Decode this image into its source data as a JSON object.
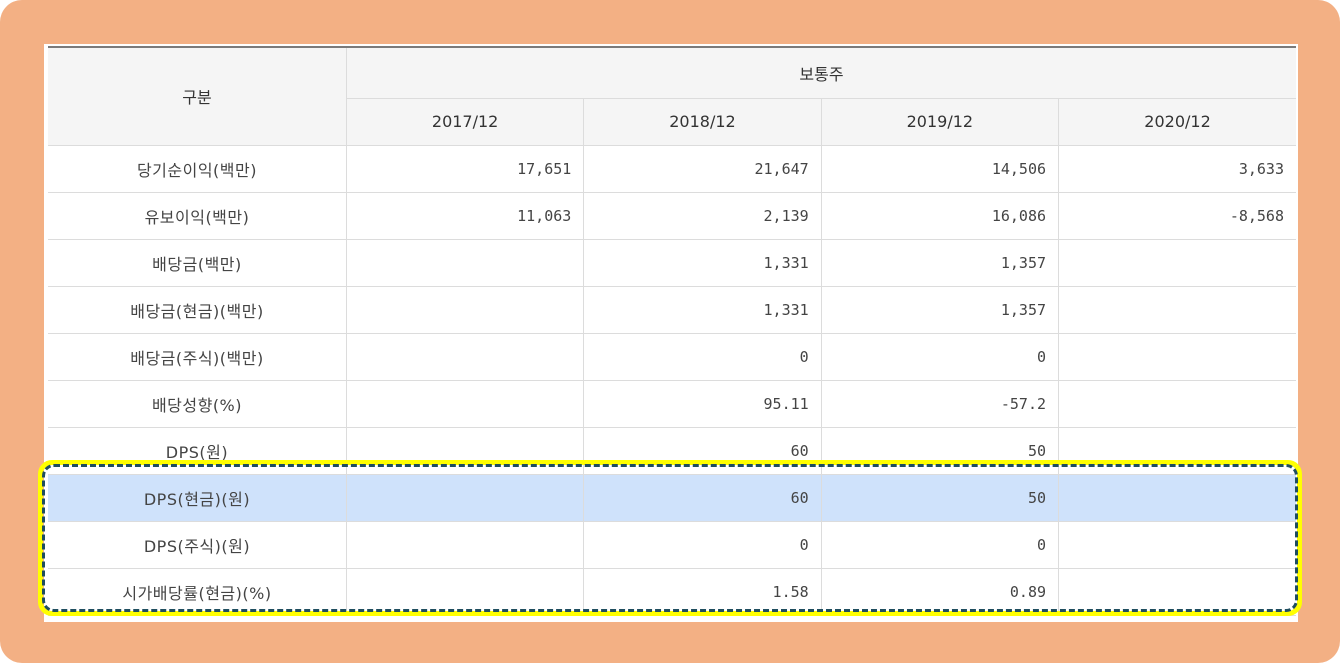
{
  "table": {
    "category_header": "구분",
    "group_header": "보통주",
    "years": [
      "2017/12",
      "2018/12",
      "2019/12",
      "2020/12"
    ],
    "rows": [
      {
        "label": "당기순이익(백만)",
        "values": [
          "17,651",
          "21,647",
          "14,506",
          "3,633"
        ]
      },
      {
        "label": "유보이익(백만)",
        "values": [
          "11,063",
          "2,139",
          "16,086",
          "-8,568"
        ]
      },
      {
        "label": "배당금(백만)",
        "values": [
          "",
          "1,331",
          "1,357",
          ""
        ]
      },
      {
        "label": "배당금(현금)(백만)",
        "values": [
          "",
          "1,331",
          "1,357",
          ""
        ]
      },
      {
        "label": "배당금(주식)(백만)",
        "values": [
          "",
          "0",
          "0",
          ""
        ]
      },
      {
        "label": "배당성향(%)",
        "values": [
          "",
          "95.11",
          "-57.2",
          ""
        ]
      },
      {
        "label": "DPS(원)",
        "values": [
          "",
          "60",
          "50",
          ""
        ]
      },
      {
        "label": "DPS(현금)(원)",
        "values": [
          "",
          "60",
          "50",
          ""
        ]
      },
      {
        "label": "DPS(주식)(원)",
        "values": [
          "",
          "0",
          "0",
          ""
        ]
      },
      {
        "label": "시가배당률(현금)(%)",
        "values": [
          "",
          "1.58",
          "0.89",
          ""
        ]
      }
    ]
  },
  "colors": {
    "frame_background": "#f3b084",
    "highlight_row": "#cfe2fb",
    "callout_outer": "#ffff00",
    "callout_dash": "#1f4e5f"
  }
}
